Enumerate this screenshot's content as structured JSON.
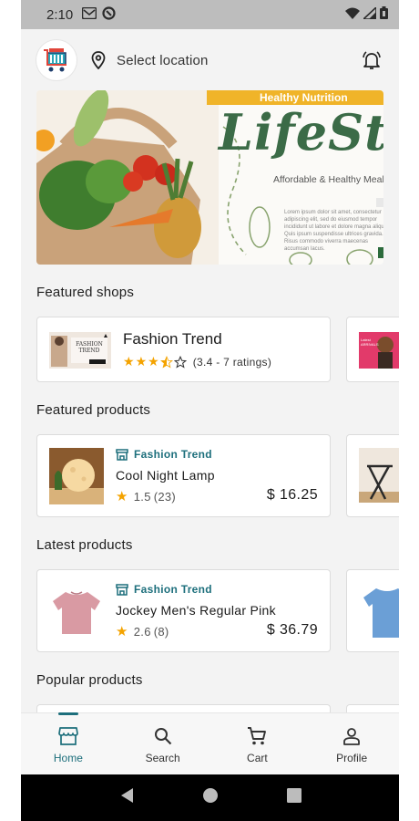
{
  "status_bar": {
    "time": "2:10"
  },
  "header": {
    "location_label": "Select location"
  },
  "banner": {
    "tag": "Healthy Nutrition",
    "headline": "LifeStyle",
    "subtitle": "Affordable & Healthy Meals",
    "body": "Lorem ipsum dolor sit amet, consectetur adipiscing elit, sed do eiusmod tempor incididunt ut labore et dolore magna aliqua. Quis ipsum suspendisse ultrices gravida. Risus commodo viverra maecenas accumsan lacus."
  },
  "featured_shops": {
    "title": "Featured shops",
    "items": [
      {
        "name": "Fashion Trend",
        "rating_value": 3.4,
        "rating_text": "(3.4 - 7 ratings)",
        "thumb_text": "FASHION TREND"
      }
    ],
    "peek_thumb_text": "Latest ARRIVALS"
  },
  "featured_products": {
    "title": "Featured products",
    "items": [
      {
        "shop": "Fashion Trend",
        "name": "Cool Night Lamp",
        "rating": "1.5",
        "count": "(23)",
        "price": "$ 16.25"
      }
    ]
  },
  "latest_products": {
    "title": "Latest products",
    "items": [
      {
        "shop": "Fashion Trend",
        "name": "Jockey Men's Regular Pink",
        "rating": "2.6",
        "count": "(8)",
        "price": "$ 36.79"
      }
    ]
  },
  "popular_products": {
    "title": "Popular products"
  },
  "bottom_nav": [
    {
      "label": "Home",
      "icon": "store-icon",
      "active": true
    },
    {
      "label": "Search",
      "icon": "search-icon",
      "active": false
    },
    {
      "label": "Cart",
      "icon": "cart-icon",
      "active": false
    },
    {
      "label": "Profile",
      "icon": "person-icon",
      "active": false
    }
  ],
  "colors": {
    "accent": "#1d6f7c",
    "star": "#f4a300",
    "banner_green": "#3b6b47",
    "banner_tag": "#f0b429"
  }
}
